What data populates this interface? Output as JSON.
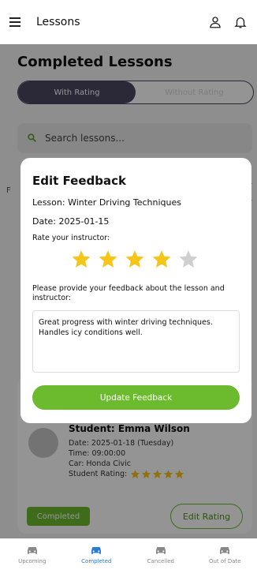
{
  "header": {
    "title": "Lessons",
    "menu_icon": "menu-icon",
    "user_icon": "user-icon",
    "bell_icon": "bell-icon"
  },
  "page": {
    "heading": "Completed Lessons",
    "segments": [
      "With Rating",
      "Without Rating"
    ],
    "active_segment": "With Rating",
    "search_placeholder": "Search lessons...",
    "filter_label": "F"
  },
  "card": {
    "student": "Student: Emma Wilson",
    "date": "Date: 2025-01-18 (Tuesday)",
    "time": "Time: 09:00:00",
    "car": "Car: Honda Civic",
    "rating_label": "Student Rating:",
    "rating": 5,
    "status": "Completed",
    "edit_label": "Edit Rating"
  },
  "modal": {
    "title": "Edit Feedback",
    "lesson": "Lesson: Winter Driving Techniques",
    "date": "Date: 2025-01-15",
    "rate_label": "Rate your instructor:",
    "rating": 4,
    "rating_max": 5,
    "prompt": "Please provide your feedback about the lesson and instructor:",
    "feedback": "Great progress with winter driving techniques. Handles icy conditions well.",
    "button": "Update Feedback"
  },
  "bottom_nav": [
    {
      "label": "Upcoming",
      "icon": "car-icon",
      "active": false
    },
    {
      "label": "Completed",
      "icon": "car-icon",
      "active": true
    },
    {
      "label": "Cancelled",
      "icon": "car-icon",
      "active": false
    },
    {
      "label": "Out of Date",
      "icon": "car-icon",
      "active": false
    }
  ],
  "colors": {
    "accent": "#6cbb2e",
    "segment_active": "#4a4560",
    "star_on": "#f5c518",
    "star_off": "#cfcfcf",
    "nav_active": "#2b7bd8",
    "nav_inactive": "#888888"
  }
}
